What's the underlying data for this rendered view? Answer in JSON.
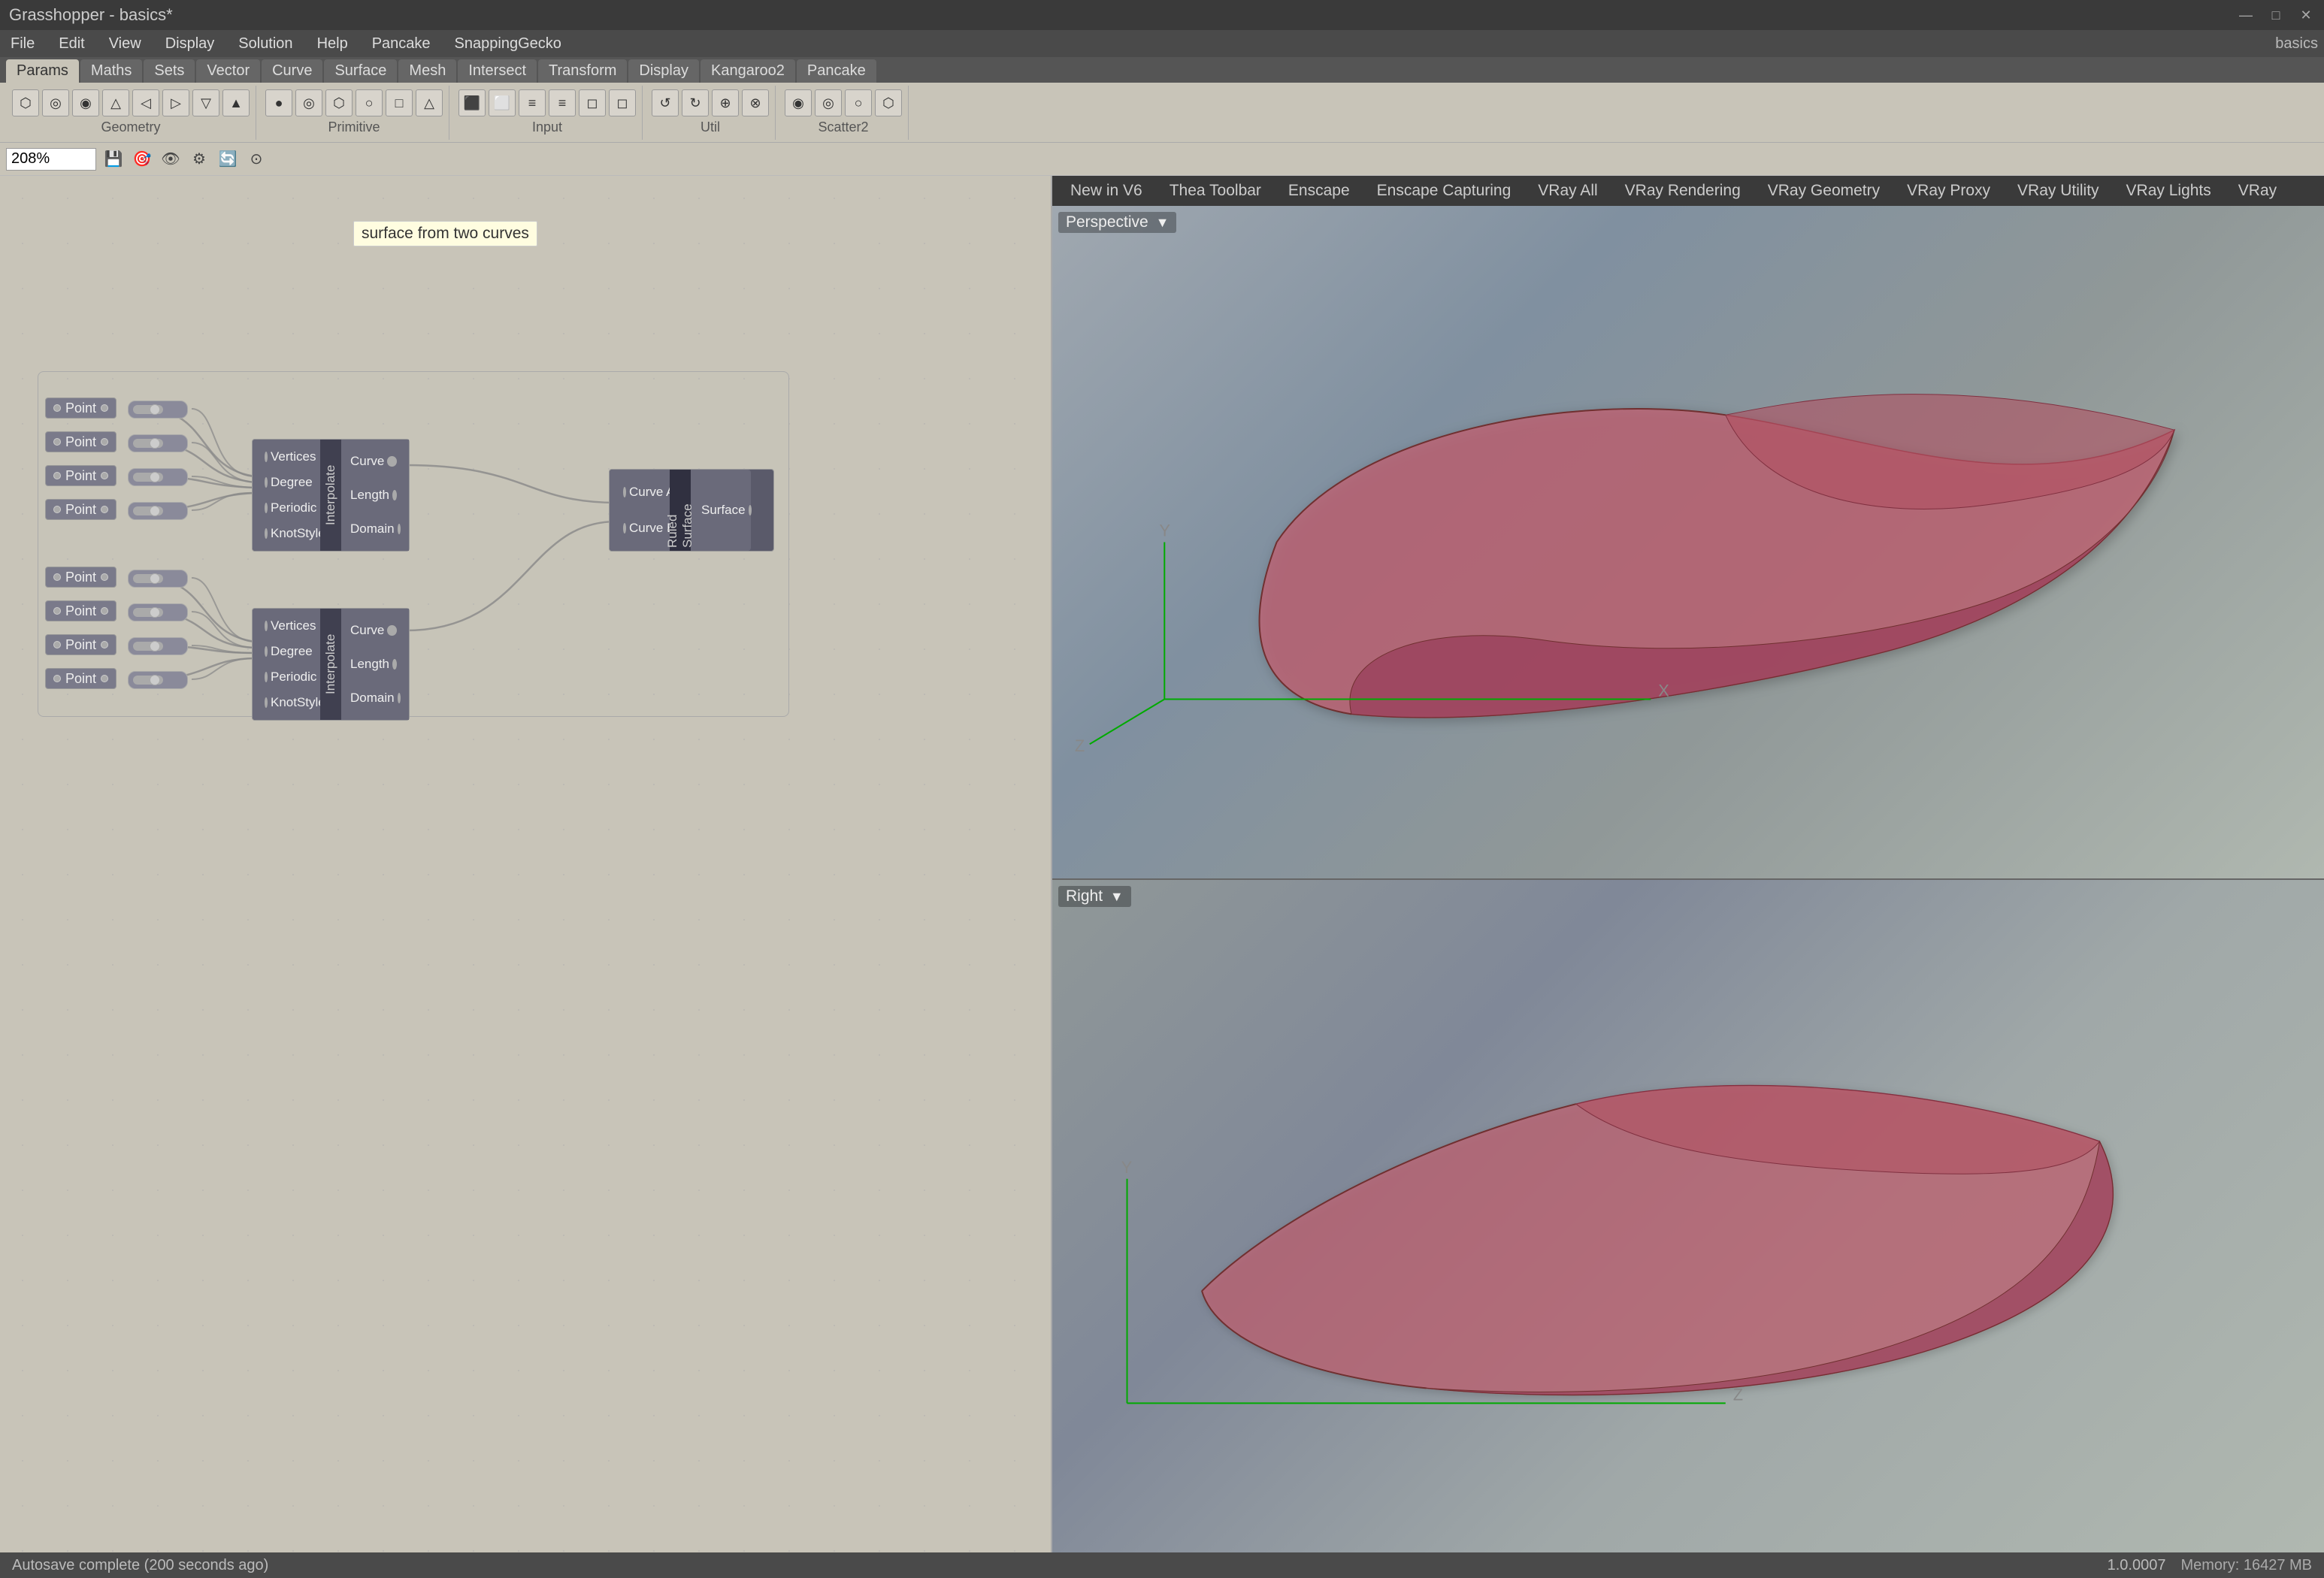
{
  "window": {
    "title": "Grasshopper - basics*",
    "project": "basics",
    "controls": [
      "—",
      "□",
      "✕"
    ]
  },
  "menu": {
    "items": [
      "File",
      "Edit",
      "View",
      "Display",
      "Solution",
      "Help",
      "Pancake",
      "SnappingGecko"
    ],
    "right": "basics"
  },
  "ribbon": {
    "tabs": [
      "Params",
      "Maths",
      "Sets",
      "Vector",
      "Curve",
      "Surface",
      "Mesh",
      "Intersect",
      "Transform",
      "Display",
      "Kangaroo2",
      "Pancake"
    ],
    "active": "Params"
  },
  "toolbar": {
    "groups": [
      {
        "label": "Geometry",
        "icons": [
          "⬡",
          "◎",
          "◉",
          "△",
          "□",
          "◇",
          "○",
          "⬟"
        ]
      },
      {
        "label": "Primitive",
        "icons": [
          "●",
          "◎",
          "⬡",
          "○",
          "□",
          "△"
        ]
      },
      {
        "label": "Input",
        "icons": [
          "⬛",
          "⬜",
          "≡",
          "≡",
          "◻",
          "◻",
          "▲",
          "▼",
          "↺",
          "↻"
        ]
      },
      {
        "label": "Util",
        "icons": [
          "⊕",
          "⊗",
          "⊙",
          "⊚",
          "⬡",
          "⬟"
        ]
      },
      {
        "label": "Scatter2",
        "icons": [
          "◉",
          "◎",
          "○",
          "⬡"
        ]
      }
    ]
  },
  "toolbar2": {
    "zoom": "208%",
    "icons": [
      "💾",
      "🎯",
      "👁",
      "🔧",
      "🔄"
    ]
  },
  "canvas": {
    "tooltip": "surface from two curves",
    "nodes": {
      "group_label": "surface from two curves",
      "upper_interpolate": {
        "label": "Interpolate",
        "ports_left": [
          "Vertices",
          "Degree",
          "Periodic",
          "KnotStyle"
        ],
        "ports_right": [
          "Curve",
          "Length",
          "Domain"
        ]
      },
      "lower_interpolate": {
        "label": "Interpolate",
        "ports_left": [
          "Vertices",
          "Degree",
          "Periodic",
          "KnotStyle"
        ],
        "ports_right": [
          "Curve",
          "Length",
          "Domain"
        ]
      },
      "ruled_surface": {
        "label": "Ruled Surface",
        "ports_left": [
          "Curve A",
          "Curve B"
        ],
        "ports_right": [
          "Surface"
        ]
      },
      "upper_points": [
        "Point",
        "Point",
        "Point",
        "Point"
      ],
      "lower_points": [
        "Point",
        "Point",
        "Point",
        "Point"
      ]
    }
  },
  "rhino": {
    "toolbar_tabs": [
      "New in V6",
      "Thea Toolbar",
      "Enscape",
      "Enscape Capturing",
      "VRay All",
      "VRay Rendering",
      "VRay Geometry",
      "VRay Proxy",
      "VRay Utility",
      "VRay Lights",
      "VRay"
    ],
    "viewports": [
      {
        "name": "Perspective",
        "type": "perspective"
      },
      {
        "name": "Right",
        "type": "right"
      }
    ]
  },
  "status": {
    "autosave": "Autosave complete (200 seconds ago)",
    "value": "1.0.0007",
    "memory": "Memory: 16427 MB"
  },
  "colors": {
    "canvas_bg": "#c8c4b8",
    "node_body": "#6a6a7a",
    "node_dark": "#5a5a6a",
    "node_label": "#404050",
    "shape_fill": "#c06070",
    "shape_stroke": "#903040",
    "viewport_bg_top": "#a0a8b0",
    "viewport_bg_bottom": "#909898",
    "axis_color": "#00aa00"
  }
}
